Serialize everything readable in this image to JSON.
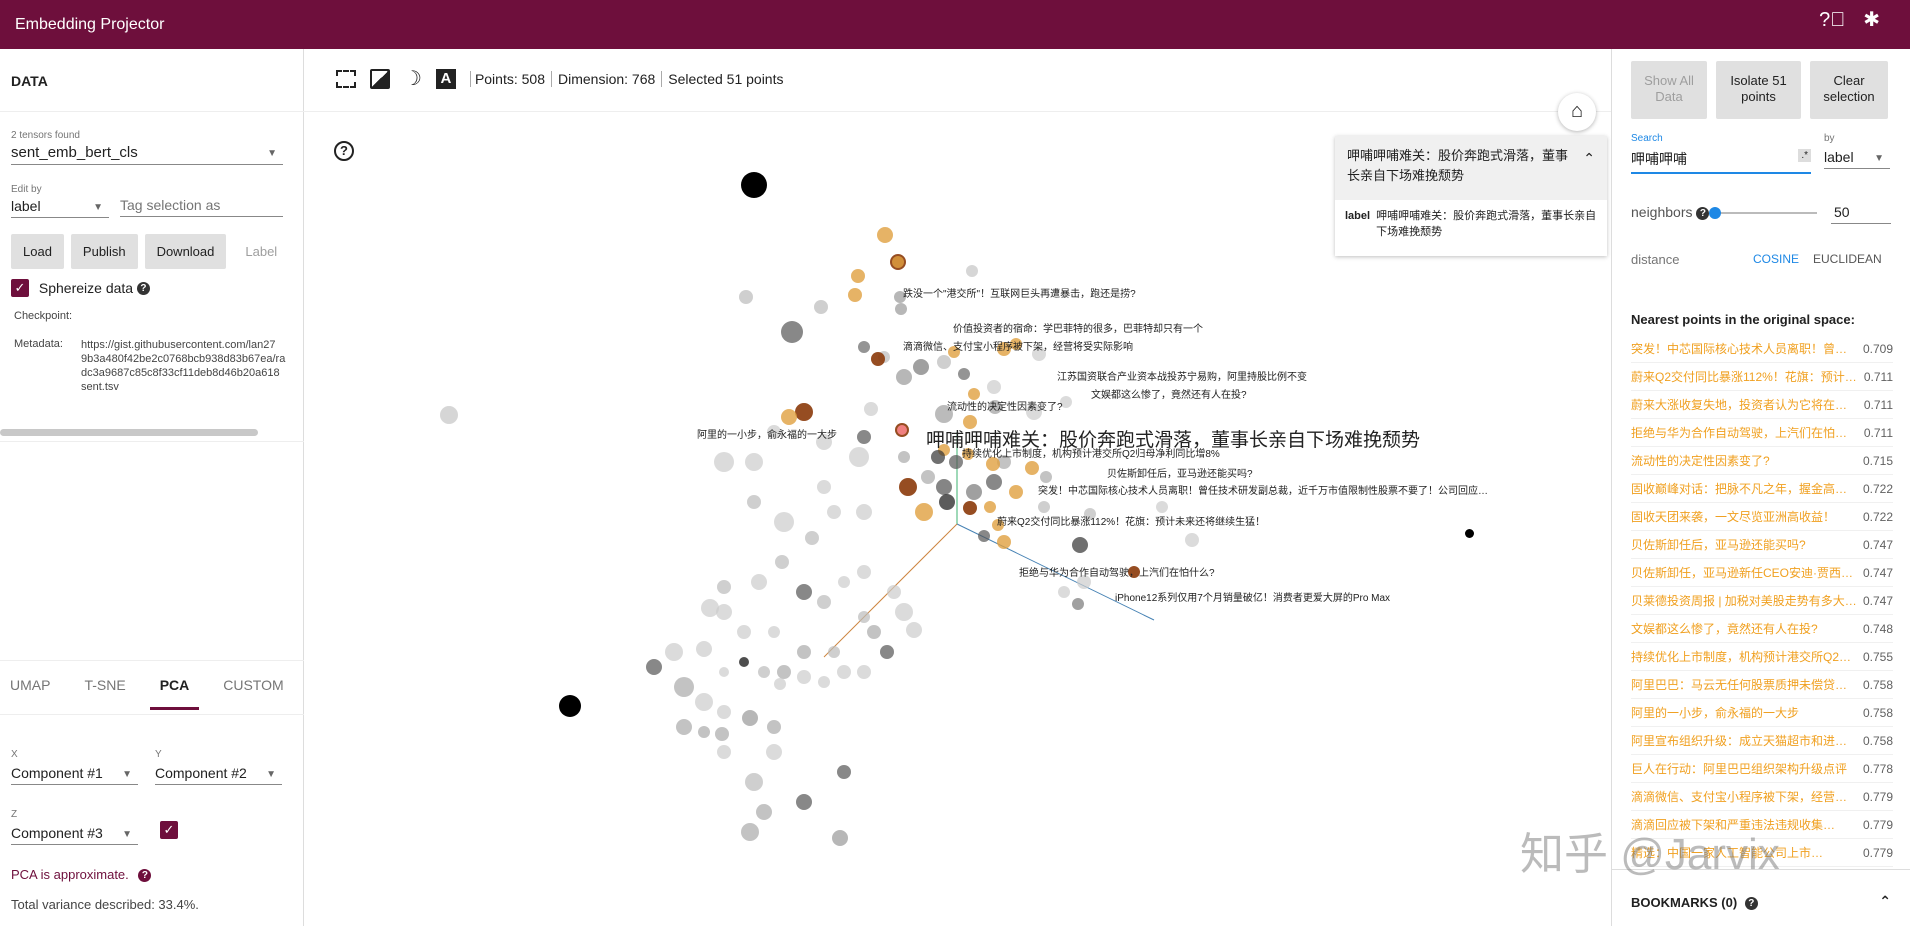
{
  "app": {
    "title": "Embedding Projector"
  },
  "data_panel": {
    "header": "DATA",
    "tensors_found": "2 tensors found",
    "tensor": "sent_emb_bert_cls",
    "edit_by_label": "Edit by",
    "edit_by": "label",
    "tag_placeholder": "Tag selection as",
    "buttons": {
      "load": "Load",
      "publish": "Publish",
      "download": "Download",
      "label": "Label"
    },
    "sphereize": "Sphereize data",
    "checkpoint_label": "Checkpoint:",
    "metadata_label": "Metadata:",
    "metadata_lines": [
      "https://gist.githubusercontent.com/lan27",
      "9b3a480f42be2c0768bcb938d83b67ea/ra",
      "dc3a9687c85c8f33cf11deb8d46b20a618",
      "sent.tsv"
    ]
  },
  "projection": {
    "tabs": [
      "UMAP",
      "T-SNE",
      "PCA",
      "CUSTOM"
    ],
    "active_tab": "PCA",
    "x_label": "X",
    "x_value": "Component #1",
    "y_label": "Y",
    "y_value": "Component #2",
    "z_label": "Z",
    "z_value": "Component #3",
    "approx": "PCA is approximate.",
    "variance": "Total variance described: 33.4%."
  },
  "toolbar": {
    "points": "Points: 508",
    "dimension": "Dimension: 768",
    "selected": "Selected 51 points"
  },
  "selected_card": {
    "title": "呷哺呷哺难关：股价奔跑式滑落，董事长亲自下场难挽颓势",
    "label_key": "label",
    "label_value": "呷哺呷哺难关：股价奔跑式滑落，董事长亲自下场难挽颓势"
  },
  "scatter": {
    "big_label": "呷哺呷哺难关：股价奔跑式滑落，董事长亲自下场难挽颓势",
    "labels": [
      "跌没一个\"港交所\"！互联网巨头再遭暴击，跑还是捞?",
      "价值投资者的宿命：学巴菲特的很多，巴菲特却只有一个",
      "滴滴微信、支付宝小程序被下架，经营将受实际影响",
      "江苏国资联合产业资本战投苏宁易购，阿里持股比例不变",
      "文娱都这么惨了，竟然还有人在投?",
      "流动性的决定性因素变了?",
      "阿里的一小步，俞永福的一大步",
      "持续优化上市制度，机构预计港交所Q2归母净利同比增8%",
      "贝佐斯卸任后，亚马逊还能买吗?",
      "突发！中芯国际核心技术人员离职！曾任技术研发副总裁，近千万市值限制性股票不要了！公司回应…",
      "蔚来Q2交付同比暴涨112%！花旗：预计未来还将继续生猛！",
      "拒绝与华为合作自动驾驶，上汽们在怕什么?",
      "iPhone12系列仅用7个月销量破亿！消费者更爱大屏的Pro Max"
    ]
  },
  "inspector": {
    "buttons": {
      "show_all": "Show All Data",
      "isolate": "Isolate 51 points",
      "clear": "Clear selection"
    },
    "search_label": "Search",
    "search_value": "呷哺呷哺",
    "regex": ".*",
    "by_label": "by",
    "by_value": "label",
    "neighbors_label": "neighbors",
    "neighbors_value": "50",
    "neighbors_fraction": 0.02,
    "distance_label": "distance",
    "cosine": "COSINE",
    "euclidean": "EUCLIDEAN",
    "nearest_header": "Nearest points in the original space:",
    "bookmarks": "BOOKMARKS (0)",
    "nearest": [
      {
        "t": "突发！中芯国际核心技术人员离职！曾…",
        "v": "0.709"
      },
      {
        "t": "蔚来Q2交付同比暴涨112%！花旗：预计…",
        "v": "0.711"
      },
      {
        "t": "蔚来大涨收复失地，投资者认为它将在…",
        "v": "0.711"
      },
      {
        "t": "拒绝与华为合作自动驾驶，上汽们在怕…",
        "v": "0.711"
      },
      {
        "t": "流动性的决定性因素变了?",
        "v": "0.715"
      },
      {
        "t": "固收巅峰对话：把脉不凡之年，握金高…",
        "v": "0.722"
      },
      {
        "t": "固收天团来袭，一文尽览亚洲高收益！",
        "v": "0.722"
      },
      {
        "t": "贝佐斯卸任后，亚马逊还能买吗?",
        "v": "0.747"
      },
      {
        "t": "贝佐斯卸任，亚马逊新任CEO安迪·贾西…",
        "v": "0.747"
      },
      {
        "t": "贝莱德投资周报 | 加税对美股走势有多大…",
        "v": "0.747"
      },
      {
        "t": "文娱都这么惨了，竟然还有人在投?",
        "v": "0.748"
      },
      {
        "t": "持续优化上市制度，机构预计港交所Q2…",
        "v": "0.755"
      },
      {
        "t": "阿里巴巴：马云无任何股票质押未偿贷…",
        "v": "0.758"
      },
      {
        "t": "阿里的一小步，俞永福的一大步",
        "v": "0.758"
      },
      {
        "t": "阿里宣布组织升级：成立天猫超市和进…",
        "v": "0.758"
      },
      {
        "t": "巨人在行动：阿里巴巴组织架构升级点评",
        "v": "0.778"
      },
      {
        "t": "滴滴微信、支付宝小程序被下架，经营…",
        "v": "0.779"
      },
      {
        "t": "滴滴回应被下架和严重违法违规收集…",
        "v": "0.779"
      },
      {
        "t": "精选：中国一家人工智能公司上市…",
        "v": "0.779"
      }
    ]
  },
  "watermark": "知乎 @Jarvix",
  "colors": {
    "brand": "#6e0f3c",
    "accent": "#f0a020",
    "link": "#1e88e5"
  }
}
